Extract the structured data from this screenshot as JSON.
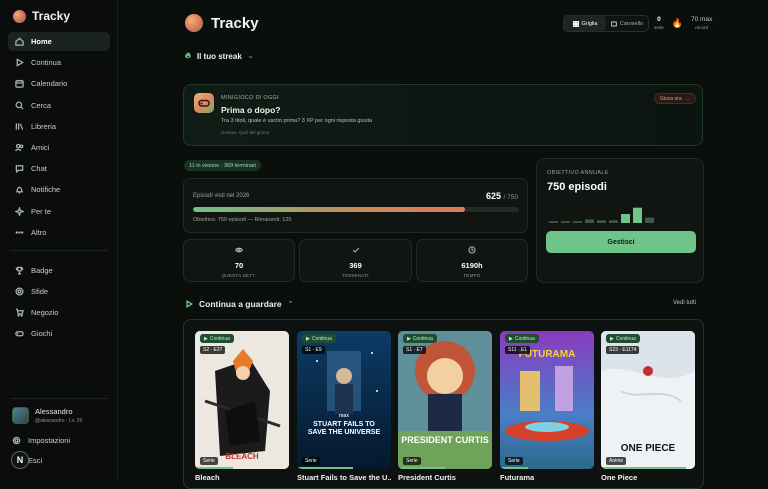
{
  "app": {
    "name": "Tracky"
  },
  "sidebar": {
    "items": [
      {
        "label": "Home",
        "icon": "home-icon",
        "active": true
      },
      {
        "label": "Continua",
        "icon": "play-icon"
      },
      {
        "label": "Calendario",
        "icon": "calendar-icon"
      },
      {
        "label": "Cerca",
        "icon": "search-icon"
      },
      {
        "label": "Libreria",
        "icon": "library-icon"
      },
      {
        "label": "Amici",
        "icon": "friends-icon"
      },
      {
        "label": "Chat",
        "icon": "chat-icon"
      },
      {
        "label": "Notifiche",
        "icon": "bell-icon"
      },
      {
        "label": "Per te",
        "icon": "sparkle-icon"
      },
      {
        "label": "Altro",
        "icon": "more-icon"
      }
    ],
    "items2": [
      {
        "label": "Badge",
        "icon": "trophy-icon"
      },
      {
        "label": "Sfide",
        "icon": "target-icon"
      },
      {
        "label": "Negozio",
        "icon": "cart-icon"
      },
      {
        "label": "Giochi",
        "icon": "gamepad-icon"
      }
    ],
    "user": {
      "name": "Alessandro",
      "sub": "@alessandro · Lv. 29"
    },
    "settings_label": "Impostazioni",
    "logout_label": "Esci",
    "badge_letter": "N"
  },
  "header": {
    "title": "Tracky",
    "view_grid": "Griglia",
    "view_carousel": "Carosello",
    "series_value": "0",
    "series_label": "serie",
    "record_value": "70 max",
    "record_label": "record"
  },
  "streak": {
    "label": "Il tuo streak"
  },
  "minigame": {
    "kicker": "MINIGIOCO DI OGGI",
    "title": "Prima o dopo?",
    "desc": "Tra 3 titoli, quale è uscito prima? 3 XP per ogni risposta giusta",
    "next": "Domani: Quiz del giorno",
    "play_label": "Gioca ora"
  },
  "stats": {
    "pill": "11 in visione · 369 terminati",
    "episodes_label": "Episodi visti nel 2026",
    "episodes_value": "625",
    "episodes_total": "/ 750",
    "progress_fraction": 0.833,
    "goal_text": "Obiettivo: 750 episodi — Rimanenti: 125",
    "boxes": [
      {
        "value": "70",
        "label": "QUESTA SETT.",
        "icon": "eye-icon"
      },
      {
        "value": "369",
        "label": "TERMINATI",
        "icon": "check-icon"
      },
      {
        "value": "6190h",
        "label": "TEMPO",
        "icon": "clock-icon"
      }
    ]
  },
  "annual": {
    "kicker": "OBIETTIVO ANNUALE",
    "value": "750 episodi",
    "button": "Gestisci",
    "bars": [
      0.1,
      0.1,
      0.1,
      0.2,
      0.15,
      0.15,
      0.5,
      0.85,
      0.3
    ]
  },
  "continue": {
    "title": "Continua a guardare",
    "see_all": "Vedi tutti",
    "tag_label": "Continua",
    "items": [
      {
        "title": "Bleach",
        "ep": "S2 · E27",
        "type": "Serie",
        "logo": "BLEACH",
        "progress": 0.4
      },
      {
        "title": "Stuart Fails to Save the U...",
        "ep": "S1 · E9",
        "type": "Serie",
        "logo": "STUART FAILS TO SAVE THE UNIVERSE",
        "brand": "max",
        "progress": 0.6
      },
      {
        "title": "President Curtis",
        "ep": "S1 · E7",
        "type": "Serie",
        "logo": "PRESIDENT CURTIS",
        "progress": 0.5
      },
      {
        "title": "Futurama",
        "ep": "S11 · E1",
        "type": "Serie",
        "logo": "FUTURAMA",
        "progress": 0.3
      },
      {
        "title": "One Piece",
        "ep": "S23 · E1174",
        "type": "Anime",
        "logo": "ONE PIECE",
        "progress": 0.9
      }
    ]
  },
  "colors": {
    "accent": "#6fc48a",
    "background": "#0b0f0c",
    "card": "#101512",
    "streak_orange": "#e07a5a"
  }
}
